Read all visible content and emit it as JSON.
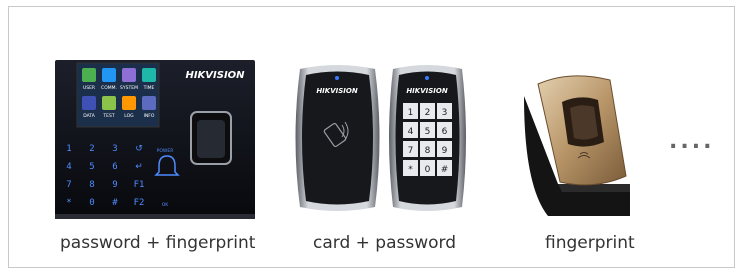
{
  "devices": [
    {
      "caption": "password + fingerprint"
    },
    {
      "caption": "card + password"
    },
    {
      "caption": "fingerprint"
    }
  ],
  "more_label": "....",
  "brand": "HIKVISION",
  "terminal": {
    "tiles": [
      "USER",
      "COMM.",
      "SYSTEM",
      "TIME",
      "DATA",
      "TEST",
      "LOG",
      "INFO"
    ],
    "keys": [
      "1",
      "2",
      "3",
      "",
      "4",
      "5",
      "6",
      "",
      "7",
      "8",
      "9",
      "F1",
      "*",
      "0",
      "#",
      "F2"
    ],
    "power_label": "POWER",
    "ok_label": "OK"
  },
  "keypad": {
    "keys": [
      "1",
      "2",
      "3",
      "4",
      "5",
      "6",
      "7",
      "8",
      "9",
      "*",
      "0",
      "#"
    ]
  }
}
